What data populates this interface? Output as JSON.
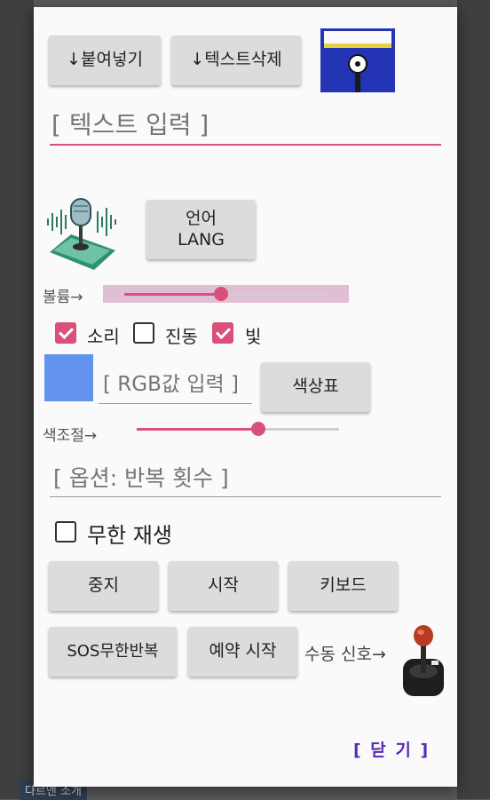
{
  "toolbar": {
    "paste_label": "↓붙여넣기",
    "delete_text_label": "↓텍스트삭제",
    "save_icon": "floppy-disk-icon"
  },
  "text_input": {
    "placeholder": "[ 텍스트 입력 ]",
    "value": ""
  },
  "mic_icon": "microphone-icon",
  "language_button": {
    "line1": "언어",
    "line2": "LANG"
  },
  "volume": {
    "label": "볼륨→",
    "level": 0.48
  },
  "options": {
    "sound": {
      "label": "소리",
      "checked": true
    },
    "vibration": {
      "label": "진동",
      "checked": false
    },
    "light": {
      "label": "빛",
      "checked": true
    }
  },
  "color": {
    "swatch_color": "#6293ee",
    "rgb_placeholder": "[ RGB값 입력 ]",
    "palette_button": "색상표",
    "adjust_label": "색조절→",
    "adjust_level": 0.6
  },
  "repeat_input": {
    "placeholder": "[ 옵션: 반복 횟수 ]",
    "value": ""
  },
  "infinite_play": {
    "label": "무한 재생",
    "checked": false
  },
  "controls": {
    "stop": "중지",
    "start": "시작",
    "keyboard": "키보드",
    "sos": "SOS무한반복",
    "schedule": "예약 시작",
    "manual_label": "수동 신호→",
    "joystick_icon": "joystick-icon"
  },
  "close_label": "[ 닫 기 ]",
  "background": {
    "bottom_label": "다르앤 소개"
  },
  "colors": {
    "accent": "#d9507a",
    "close_link": "#5b2ab5",
    "button_bg": "#dcdcdc"
  }
}
